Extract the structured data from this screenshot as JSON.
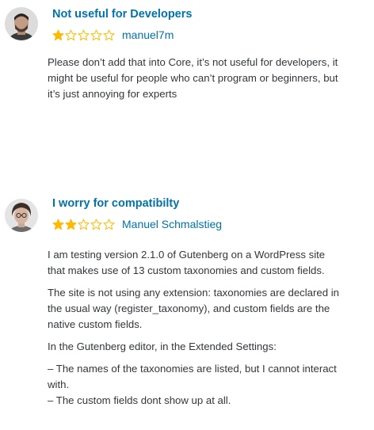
{
  "colors": {
    "link": "#0073aa",
    "star": "#ffb900",
    "text": "#32373c"
  },
  "reviews": [
    {
      "title": "Not useful for Developers",
      "rating": 1,
      "max_rating": 5,
      "author": "manuel7m",
      "paragraphs": [
        [
          "Please don’t add that into Core, it’s not useful for developers, it",
          "might be useful for people who can’t program or beginners, but",
          "it’s just annoying for experts"
        ]
      ]
    },
    {
      "title": "I worry for compatibilty",
      "rating": 2,
      "max_rating": 5,
      "author": "Manuel Schmalstieg",
      "paragraphs": [
        [
          "I am testing version 2.1.0 of Gutenberg on a WordPress site",
          "that makes use of 13 custom taxonomies and custom fields."
        ],
        [
          "The site is not using any extension: taxonomies are declared in",
          "the usual way (register_taxonomy), and custom fields are the",
          "native custom fields."
        ],
        [
          "In the Gutenberg editor, in the Extended Settings:"
        ],
        [
          "– The names of the taxonomies are listed, but I cannot interact",
          "with.",
          "– The custom fields dont show up at all."
        ]
      ]
    }
  ]
}
